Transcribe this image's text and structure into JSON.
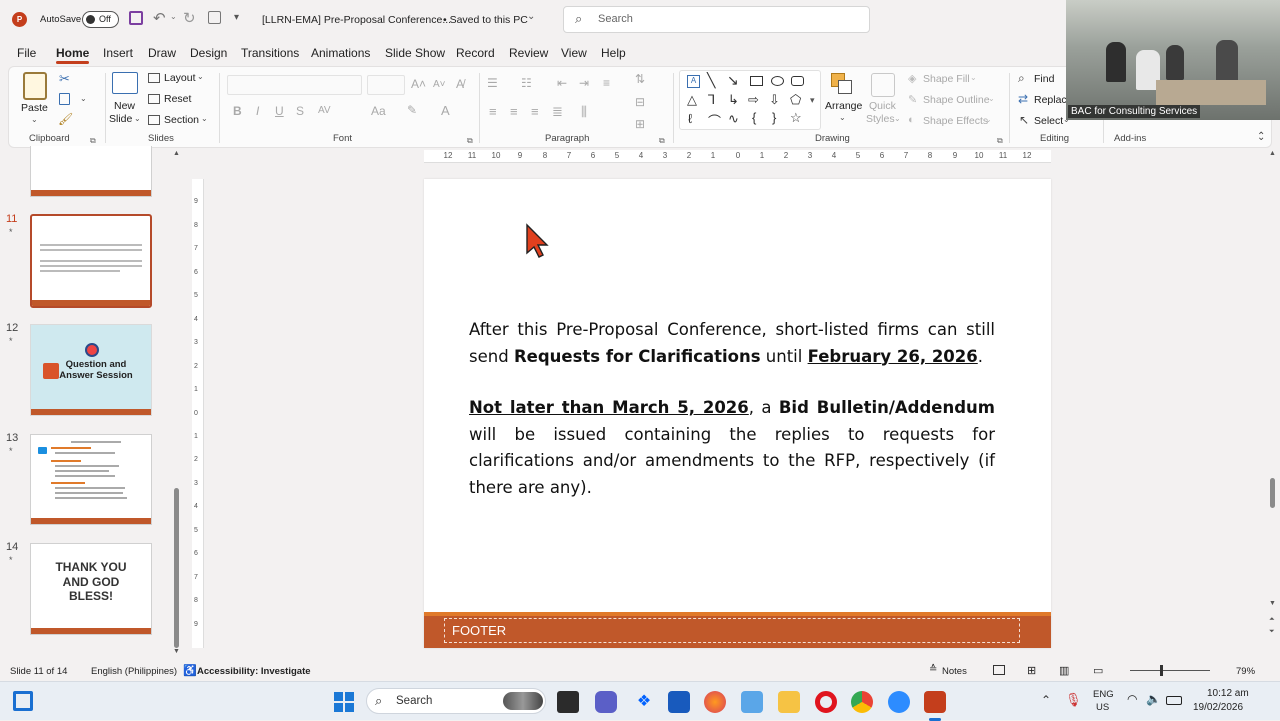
{
  "titlebar": {
    "autosave_label": "AutoSave",
    "autosave_state": "Off",
    "doc_title": "[LLRN-EMA] Pre-Proposal Conference...",
    "save_status": "• Saved to this PC",
    "search_placeholder": "Search"
  },
  "menu": [
    "File",
    "Home",
    "Insert",
    "Draw",
    "Design",
    "Transitions",
    "Animations",
    "Slide Show",
    "Record",
    "Review",
    "View",
    "Help"
  ],
  "ribbon": {
    "clipboard": {
      "paste": "Paste",
      "label": "Clipboard"
    },
    "slides": {
      "new_slide": "New",
      "new_slide2": "Slide",
      "layout": "Layout",
      "reset": "Reset",
      "section": "Section",
      "label": "Slides"
    },
    "font": {
      "label": "Font",
      "bold": "B",
      "italic": "I",
      "underline": "U",
      "strike": "S",
      "spacing": "AV",
      "case": "Aa"
    },
    "paragraph": {
      "label": "Paragraph"
    },
    "drawing": {
      "arrange": "Arrange",
      "quick_styles": "Quick",
      "quick_styles2": "Styles",
      "shape_fill": "Shape Fill",
      "shape_outline": "Shape Outline",
      "shape_effects": "Shape Effects",
      "label": "Drawing"
    },
    "editing": {
      "find": "Find",
      "replace": "Replace",
      "select": "Select",
      "label": "Editing"
    },
    "addins": {
      "label": "Add-ins"
    }
  },
  "thumbnails": [
    {
      "num": "11",
      "star": "*"
    },
    {
      "num": "12",
      "star": "*",
      "text": "Question and Answer Session"
    },
    {
      "num": "13",
      "star": "*"
    },
    {
      "num": "14",
      "star": "*",
      "text": "THANK YOU AND GOD BLESS!"
    }
  ],
  "slide": {
    "p1_a": "After this Pre-Proposal Conference, short-listed firms can still send ",
    "p1_b": "Requests for Clarifications",
    "p1_c": " until ",
    "p1_d": "February 26, 2026",
    "p1_e": ".",
    "p2_a": "Not later than March 5, 2026",
    "p2_b": ", a ",
    "p2_c": "Bid Bulletin/Addendum",
    "p2_d": " will be issued containing the replies to requests for clarifications and/or amendments to the RFP, respectively (if there are any).",
    "footer": "FOOTER"
  },
  "ruler_numbers": [
    "12",
    "11",
    "10",
    "9",
    "8",
    "7",
    "6",
    "5",
    "4",
    "3",
    "2",
    "1",
    "0",
    "1",
    "2",
    "3",
    "4",
    "5",
    "6",
    "7",
    "8",
    "9",
    "10",
    "11",
    "12"
  ],
  "video": {
    "label": "BAC for Consulting Services"
  },
  "status": {
    "slide_of": "Slide 11 of 14",
    "language": "English (Philippines)",
    "accessibility": "Accessibility: Investigate",
    "notes": "Notes",
    "zoom": "79%"
  },
  "taskbar": {
    "search": "Search",
    "lang1": "ENG",
    "lang2": "US",
    "time": "10:12 am",
    "date": "19/02/2026"
  },
  "colors": {
    "accent": "#c43e1c",
    "footer": "#c0582a"
  }
}
